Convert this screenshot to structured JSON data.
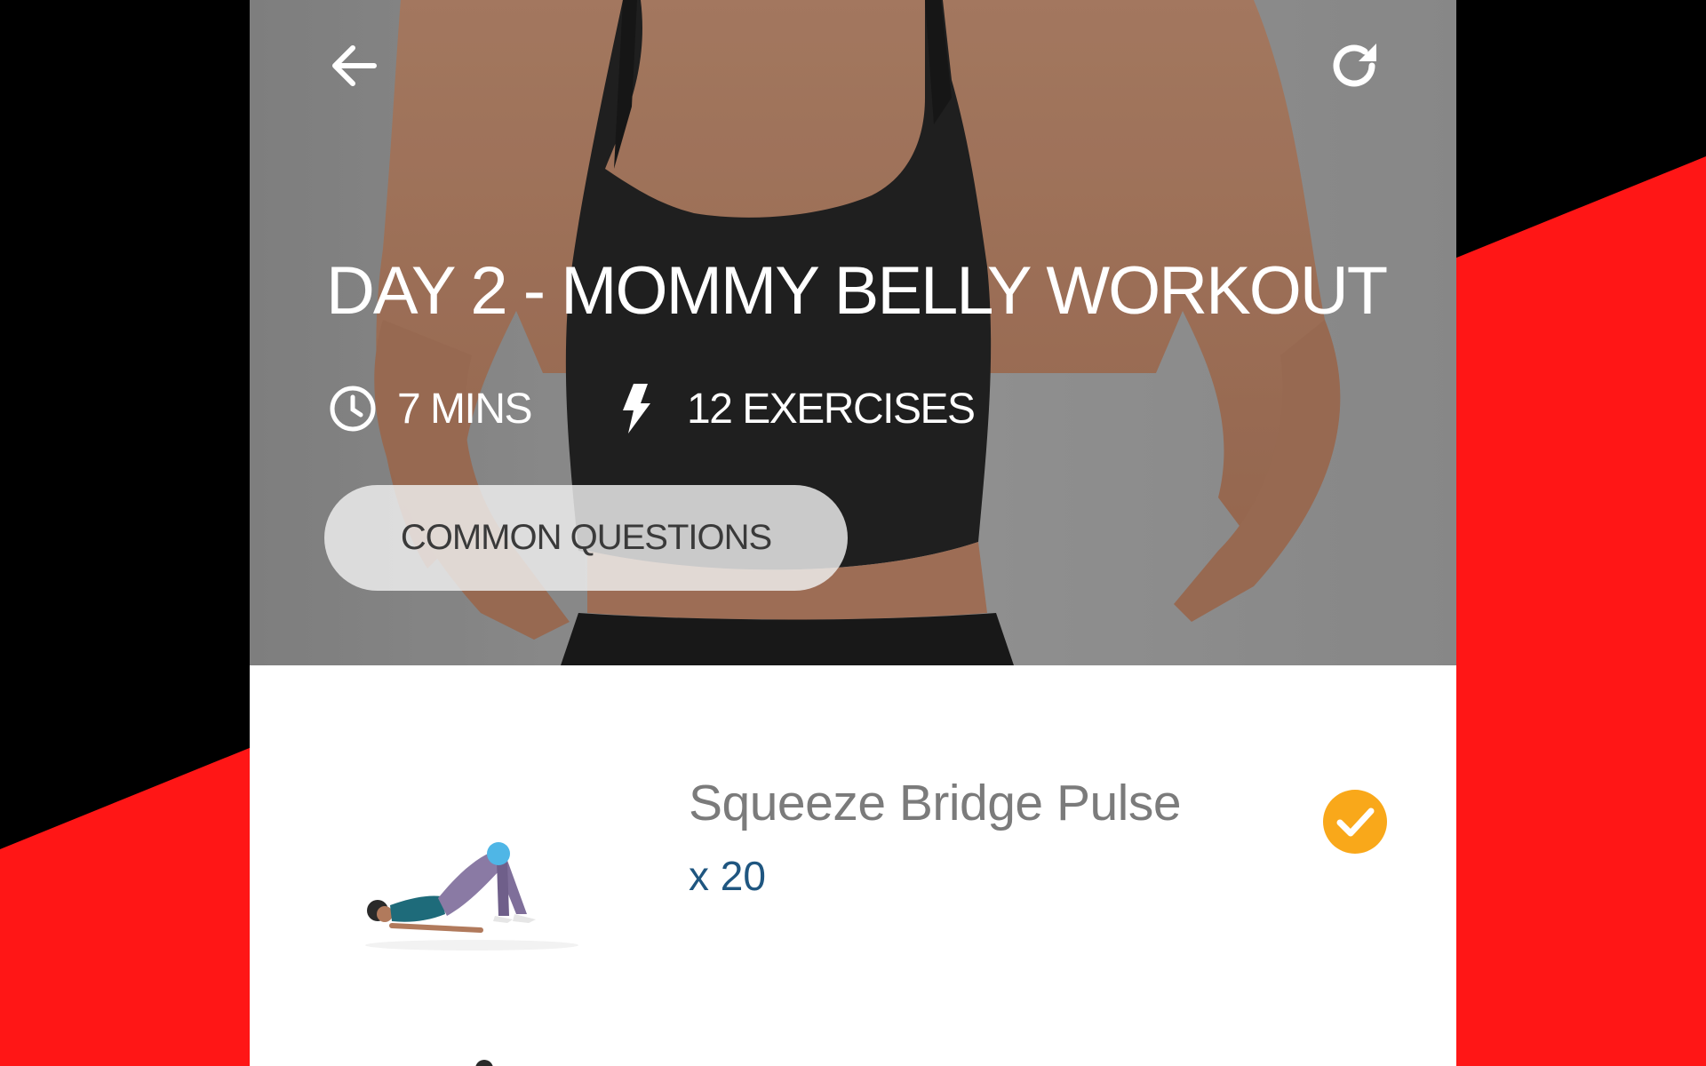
{
  "header": {
    "back_icon": "arrow-left-icon",
    "restart_icon": "refresh-icon"
  },
  "workout": {
    "title": "DAY 2 - MOMMY BELLY WORKOUT",
    "duration": "7 MINS",
    "duration_icon": "clock-icon",
    "exercise_count": "12 EXERCISES",
    "exercise_count_icon": "lightning-icon",
    "faq_label": "COMMON QUESTIONS"
  },
  "exercises": [
    {
      "name": "Squeeze Bridge Pulse",
      "reps": "x 20",
      "completed": true,
      "status_icon": "check-circle-icon"
    }
  ],
  "colors": {
    "backdrop_black": "#000000",
    "backdrop_red": "#ff1616",
    "check_orange": "#f9a81a",
    "reps_blue": "#1f5680",
    "name_gray": "#7b7b7b"
  }
}
